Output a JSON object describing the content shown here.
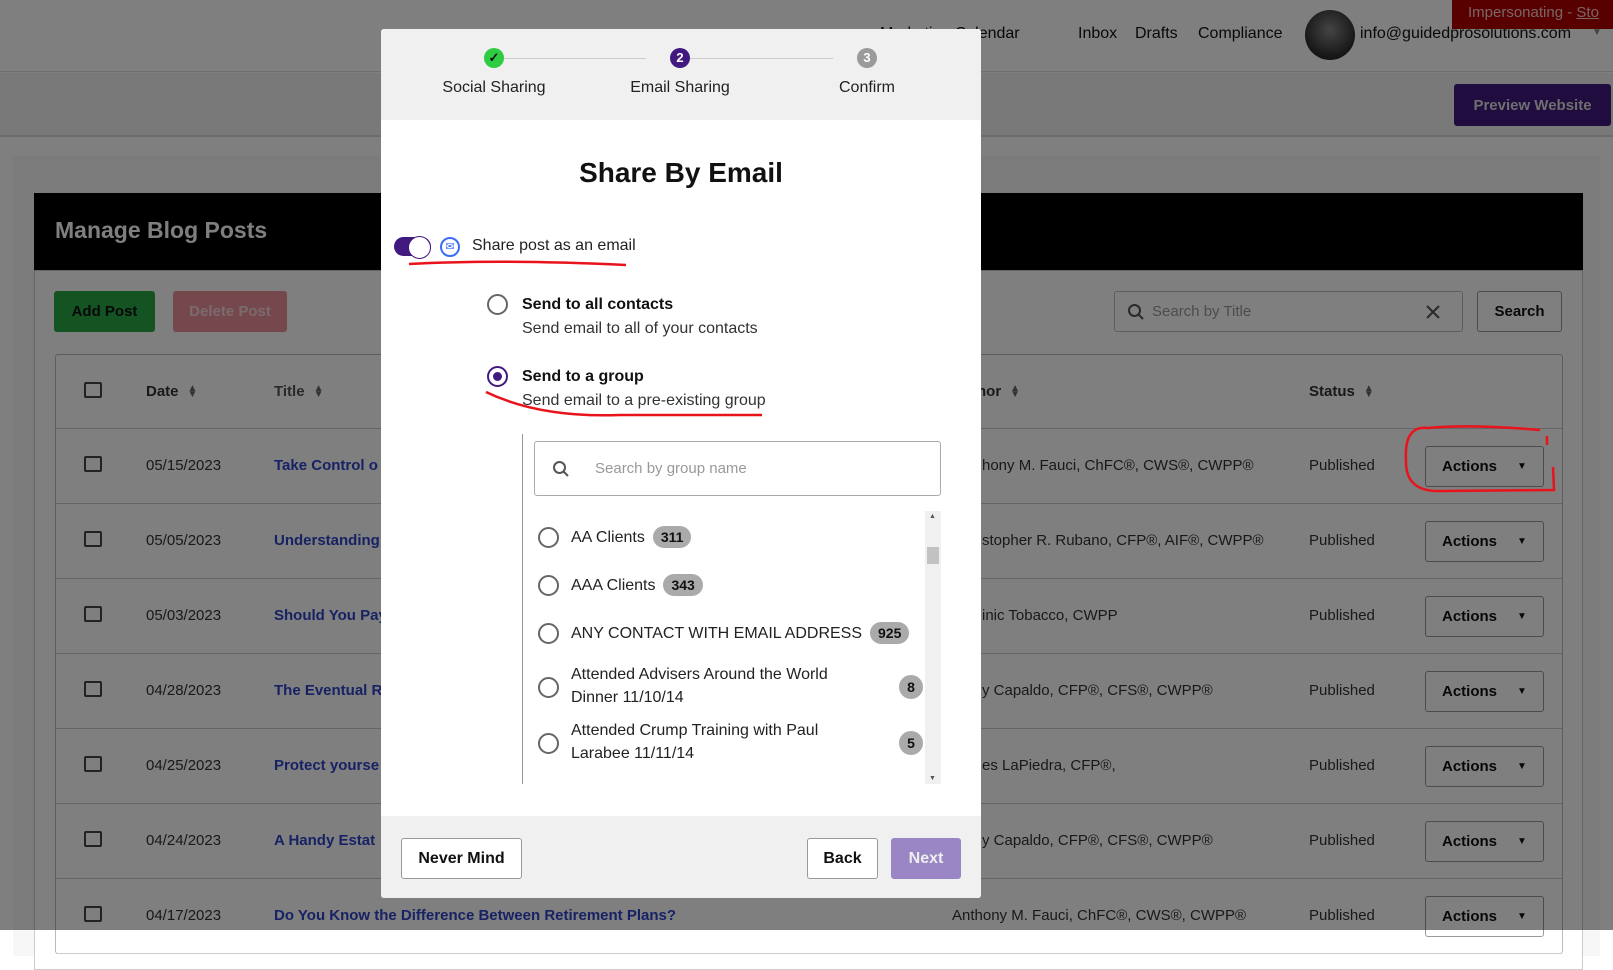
{
  "topnav": {
    "links": [
      "Marketing Calendar",
      "Inbox",
      "Drafts",
      "Compliance"
    ],
    "user_email": "info@guidedprosolutions.com",
    "impersonating_label": "Impersonating - ",
    "impersonating_stop": "Sto"
  },
  "subbar": {
    "preview_label": "Preview Website"
  },
  "page": {
    "title": "Manage Blog Posts",
    "add_label": "Add Post",
    "delete_label": "Delete Post",
    "search_placeholder": "Search by Title",
    "search_label": "Search"
  },
  "table": {
    "headers": {
      "date": "Date",
      "title": "Title",
      "author": "Author",
      "status": "Status"
    },
    "rows": [
      {
        "date": "05/15/2023",
        "title": "Take Control o",
        "author": "hony M. Fauci, ChFC®, CWS®, CWPP®",
        "status": "Published",
        "action": "Actions"
      },
      {
        "date": "05/05/2023",
        "title": "Understanding",
        "author": "stopher R. Rubano, CFP®, AIF®, CWPP®",
        "status": "Published",
        "action": "Actions"
      },
      {
        "date": "05/03/2023",
        "title": "Should You Pay",
        "author": "inic Tobacco, CWPP",
        "status": "Published",
        "action": "Actions"
      },
      {
        "date": "04/28/2023",
        "title": "The Eventual R",
        "author": "y Capaldo, CFP®, CFS®, CWPP®",
        "status": "Published",
        "action": "Actions"
      },
      {
        "date": "04/25/2023",
        "title": "Protect yourse",
        "author": "es LaPiedra, CFP®,",
        "status": "Published",
        "action": "Actions"
      },
      {
        "date": "04/24/2023",
        "title": "A Handy Estat",
        "author": "y Capaldo, CFP®, CFS®, CWPP®",
        "status": "Published",
        "action": "Actions"
      },
      {
        "date": "04/17/2023",
        "title": "Do You Know the Difference Between Retirement Plans?",
        "author": "Anthony M. Fauci, ChFC®, CWS®, CWPP®",
        "status": "Published",
        "action": "Actions"
      }
    ]
  },
  "modal": {
    "steps": [
      {
        "label": "Social Sharing",
        "state": "complete",
        "color": "#2ecc40"
      },
      {
        "label": "Email Sharing",
        "number": "2",
        "state": "current",
        "color": "#41197f"
      },
      {
        "label": "Confirm",
        "number": "3",
        "state": "upcoming",
        "color": "#9a9a9a"
      }
    ],
    "title": "Share By Email",
    "toggle": {
      "label": "Share post as an email",
      "on": true
    },
    "options": [
      {
        "label": "Send to all contacts",
        "sub": "Send email to all of your contacts",
        "selected": false
      },
      {
        "label": "Send to a group",
        "sub": "Send email to a pre-existing group",
        "selected": true
      }
    ],
    "group_search_placeholder": "Search by group name",
    "groups": [
      {
        "name": "AA Clients",
        "count": "311"
      },
      {
        "name": "AAA Clients",
        "count": "343"
      },
      {
        "name": "ANY CONTACT WITH EMAIL ADDRESS",
        "count": "925"
      },
      {
        "name": "Attended Advisers Around the World Dinner 11/10/14",
        "count": "8"
      },
      {
        "name": "Attended Crump Training with Paul Larabee 11/11/14",
        "count": "5"
      }
    ],
    "never_mind_label": "Never Mind",
    "back_label": "Back",
    "next_label": "Next"
  },
  "colors": {
    "brand_purple": "#41197f",
    "next_disabled": "#9a86c4",
    "annotation": "#e8131b"
  }
}
